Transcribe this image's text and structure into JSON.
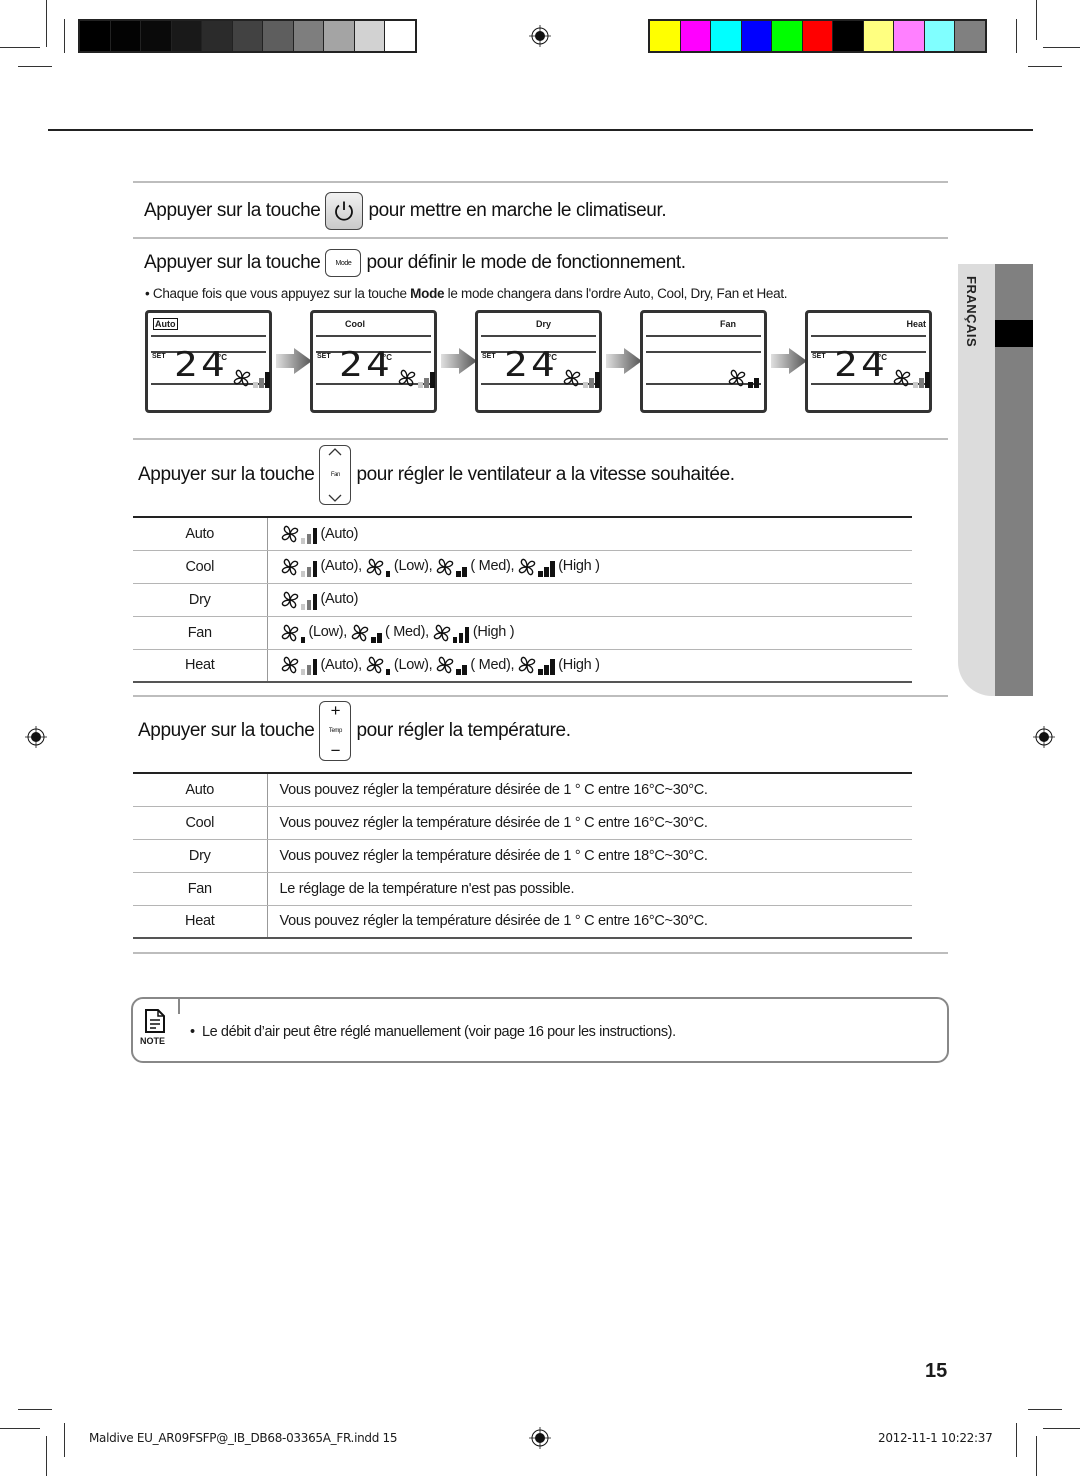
{
  "color_bars": {
    "grayscale": [
      "#000000",
      "#030303",
      "#0a0a0a",
      "#191919",
      "#2b2b2b",
      "#424242",
      "#5e5e5e",
      "#7e7e7e",
      "#a4a4a4",
      "#d2d2d2",
      "#ffffff"
    ],
    "process": [
      "#ffff00",
      "#ff00ff",
      "#00ffff",
      "#0000ff",
      "#00ff00",
      "#ff0000",
      "#000000",
      "#ffff80",
      "#ff80ff",
      "#80ffff",
      "#808080"
    ]
  },
  "sections": {
    "power": {
      "prefix": "Appuyer sur la touche",
      "suffix": "pour mettre en marche le climatiseur.",
      "key_icon": "power-icon"
    },
    "mode": {
      "prefix": "Appuyer sur la touche",
      "key_label": "Mode",
      "suffix": "pour définir le mode de fonctionnement.",
      "bullet_pre": "Chaque fois que vous appuyez sur la touche",
      "bullet_bold": "Mode",
      "bullet_post": "le mode changera dans l'ordre Auto, Cool, Dry, Fan et Heat.",
      "displays": [
        {
          "mode": "Auto",
          "set": "SET",
          "temp": "24",
          "unit": "°C",
          "fan": "auto"
        },
        {
          "mode": "Cool",
          "set": "SET",
          "temp": "24",
          "unit": "°C",
          "fan": "auto"
        },
        {
          "mode": "Dry",
          "set": "SET",
          "temp": "24",
          "unit": "°C",
          "fan": "auto"
        },
        {
          "mode": "Fan",
          "set": "",
          "temp": "",
          "unit": "",
          "fan": "med"
        },
        {
          "mode": "Heat",
          "set": "SET",
          "temp": "24",
          "unit": "°C",
          "fan": "auto"
        }
      ]
    },
    "fan": {
      "prefix": "Appuyer sur la touche",
      "key_label": "Fan",
      "suffix": "pour régler le ventilateur a la vitesse souhaitée.",
      "rows": [
        {
          "mode": "Auto",
          "speeds": [
            {
              "level": "auto",
              "label": "(Auto)"
            }
          ]
        },
        {
          "mode": "Cool",
          "speeds": [
            {
              "level": "auto",
              "label": "(Auto),"
            },
            {
              "level": "low",
              "label": "(Low),"
            },
            {
              "level": "med",
              "label": "( Med),"
            },
            {
              "level": "high",
              "label": "(High )"
            }
          ]
        },
        {
          "mode": "Dry",
          "speeds": [
            {
              "level": "auto",
              "label": "(Auto)"
            }
          ]
        },
        {
          "mode": "Fan",
          "speeds": [
            {
              "level": "low",
              "label": "(Low),"
            },
            {
              "level": "med",
              "label": "( Med),"
            },
            {
              "level": "high",
              "label": "(High )"
            }
          ]
        },
        {
          "mode": "Heat",
          "speeds": [
            {
              "level": "auto",
              "label": "(Auto),"
            },
            {
              "level": "low",
              "label": "(Low),"
            },
            {
              "level": "med",
              "label": "( Med),"
            },
            {
              "level": "high",
              "label": "(High )"
            }
          ]
        }
      ]
    },
    "temp": {
      "prefix": "Appuyer sur la touche",
      "key_label": "Temp",
      "key_plus": "+",
      "key_minus": "−",
      "suffix": "pour régler la température.",
      "rows": [
        {
          "mode": "Auto",
          "text": "Vous pouvez régler la température désirée de 1 ° C entre 16°C~30°C."
        },
        {
          "mode": "Cool",
          "text": "Vous pouvez régler la température désirée de 1 ° C entre 16°C~30°C."
        },
        {
          "mode": "Dry",
          "text": "Vous pouvez régler la température désirée de 1 ° C entre 18°C~30°C."
        },
        {
          "mode": "Fan",
          "text": "Le réglage de la température n'est pas possible."
        },
        {
          "mode": "Heat",
          "text": "Vous pouvez régler la température désirée de 1 ° C entre 16°C~30°C."
        }
      ]
    }
  },
  "note": {
    "label": "NOTE",
    "bullet": "•",
    "text": "Le débit d’air peut être réglé manuellement (voir page 16 pour les instructions)."
  },
  "side_tab": {
    "label": "FRANÇAIS"
  },
  "page_number": "15",
  "footer": {
    "file": "Maldive EU_AR09FSFP@_IB_DB68-03365A_FR.indd   15",
    "timestamp": "2012-11-1   10:22:37"
  }
}
